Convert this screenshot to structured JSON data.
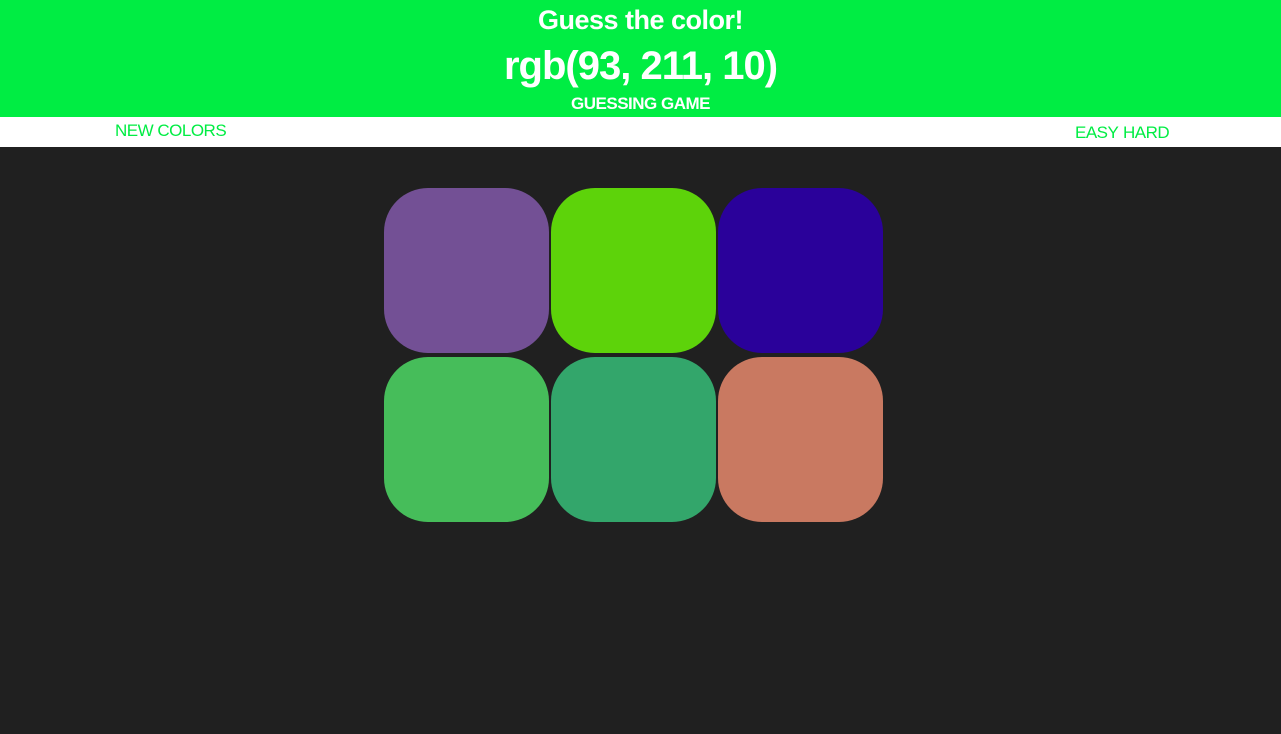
{
  "header": {
    "title": "Guess the color!",
    "rgb_target": "rgb(93, 211, 10)",
    "subtitle": "GUESSING GAME",
    "background": "#00ed43"
  },
  "nav": {
    "new_colors_label": "NEW COLORS",
    "easy_label": "EASY",
    "hard_label": "HARD",
    "accent": "#00ed43"
  },
  "squares": [
    {
      "color": "#735095"
    },
    {
      "color": "#5dd30a"
    },
    {
      "color": "#2a019a"
    },
    {
      "color": "#46bd5a"
    },
    {
      "color": "#33a66b"
    },
    {
      "color": "#c97961"
    }
  ]
}
